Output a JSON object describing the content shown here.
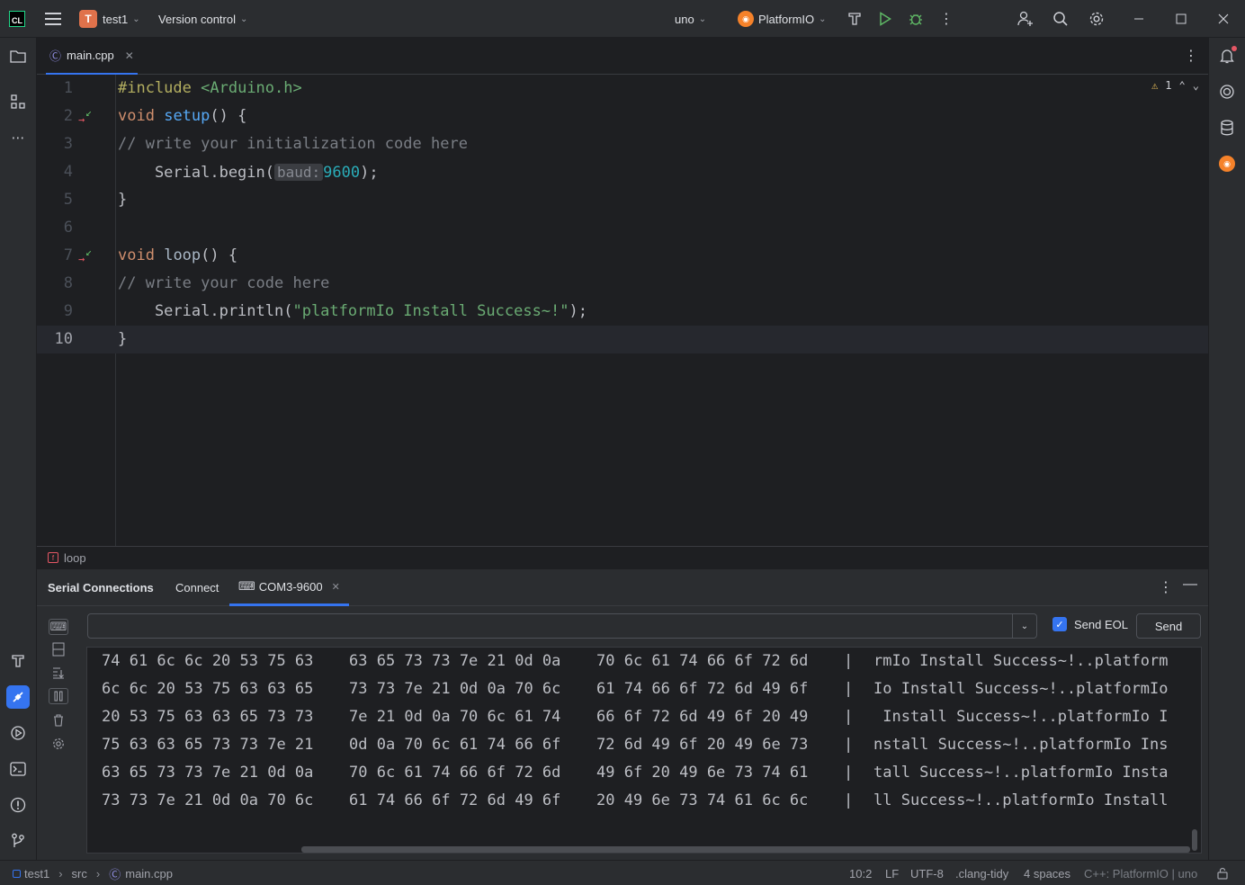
{
  "titlebar": {
    "project_initial": "T",
    "project_name": "test1",
    "vcs": "Version control",
    "board": "uno",
    "platformio": "PlatformIO",
    "window_controls": [
      "minimize",
      "maximize",
      "close"
    ]
  },
  "editor": {
    "tab_label": "main.cpp",
    "inspection_count": "1",
    "lines": [
      {
        "n": "1"
      },
      {
        "n": "2"
      },
      {
        "n": "3"
      },
      {
        "n": "4"
      },
      {
        "n": "5"
      },
      {
        "n": "6"
      },
      {
        "n": "7"
      },
      {
        "n": "8"
      },
      {
        "n": "9"
      },
      {
        "n": "10"
      }
    ],
    "code": {
      "l1_directive": "#include",
      "l1_header": "<Arduino.h>",
      "l2_kw": "void",
      "l2_fn": "setup",
      "l2_rest": "() {",
      "l3": "// write your initialization code here",
      "l4_pre": "    Serial.begin(",
      "l4_hint": "baud:",
      "l4_num": "9600",
      "l4_post": ");",
      "l5": "}",
      "l7_kw": "void",
      "l7_fn": "loop",
      "l7_rest": "() {",
      "l8": "// write your code here",
      "l9_pre": "    Serial.println(",
      "l9_str": "\"platformIo Install Success~!\"",
      "l9_post": ");",
      "l10": "}"
    },
    "breadcrumb": "loop"
  },
  "serial": {
    "title": "Serial Connections",
    "connect_tab": "Connect",
    "port_tab": "COM3-9600",
    "input_value": "",
    "send_eol_label": "Send EOL",
    "send_eol_checked": true,
    "send_label": "Send",
    "rows": [
      {
        "h1": "74 61 6c 6c 20 53 75 63",
        "h2": "63 65 73 73 7e 21 0d 0a",
        "h3": "70 6c 61 74 66 6f 72 6d",
        "sep": "|",
        "ascii": "rmIo Install Success~!..platform"
      },
      {
        "h1": "6c 6c 20 53 75 63 63 65",
        "h2": "73 73 7e 21 0d 0a 70 6c",
        "h3": "61 74 66 6f 72 6d 49 6f",
        "sep": "|",
        "ascii": "Io Install Success~!..platformIo"
      },
      {
        "h1": "20 53 75 63 63 65 73 73",
        "h2": "7e 21 0d 0a 70 6c 61 74",
        "h3": "66 6f 72 6d 49 6f 20 49",
        "sep": "|",
        "ascii": " Install Success~!..platformIo I"
      },
      {
        "h1": "75 63 63 65 73 73 7e 21",
        "h2": "0d 0a 70 6c 61 74 66 6f",
        "h3": "72 6d 49 6f 20 49 6e 73",
        "sep": "|",
        "ascii": "nstall Success~!..platformIo Ins"
      },
      {
        "h1": "63 65 73 73 7e 21 0d 0a",
        "h2": "70 6c 61 74 66 6f 72 6d",
        "h3": "49 6f 20 49 6e 73 74 61",
        "sep": "|",
        "ascii": "tall Success~!..platformIo Insta"
      },
      {
        "h1": "73 73 7e 21 0d 0a 70 6c",
        "h2": "61 74 66 6f 72 6d 49 6f",
        "h3": "20 49 6e 73 74 61 6c 6c",
        "sep": "|",
        "ascii": "ll Success~!..platformIo Install"
      }
    ]
  },
  "statusbar": {
    "project": "test1",
    "folder": "src",
    "file": "main.cpp",
    "position": "10:2",
    "line_ending": "LF",
    "encoding": "UTF-8",
    "linter": ".clang-tidy",
    "indent": "4 spaces",
    "context": "C++: PlatformIO | uno"
  },
  "colors": {
    "accent": "#3574f0",
    "run_green": "#5fb865",
    "keyword": "#cf8e6d",
    "function": "#56a8f5",
    "string": "#6aab73",
    "number": "#2aacb8",
    "comment": "#7a7e85",
    "platformio_orange": "#f5822a"
  }
}
